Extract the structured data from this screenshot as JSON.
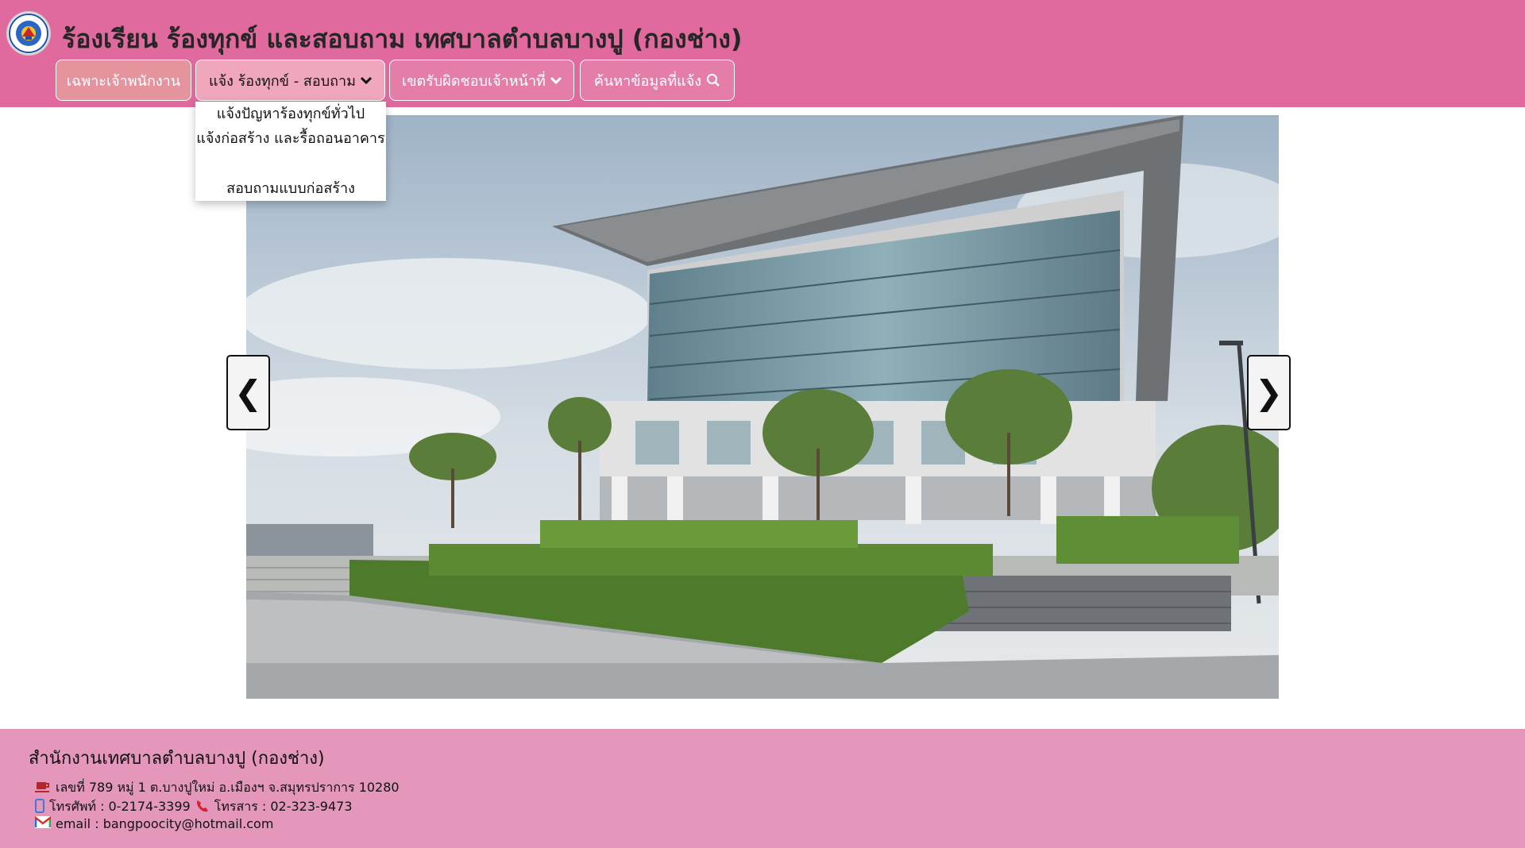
{
  "header": {
    "title": "ร้องเรียน ร้องทุกข์ และสอบถาม เทศบาลตำบลบางปู (กองช่าง)",
    "logo_icon": "municipality-seal-icon"
  },
  "nav": {
    "staff_label": "เฉพาะเจ้าพนักงาน",
    "report_label": "แจ้ง ร้องทุกข์ - สอบถาม",
    "zone_label": "เขตรับผิดชอบเจ้าหน้าที่",
    "search_label": "ค้นหาข้อมูลที่แจ้ง"
  },
  "dropdown": {
    "items": [
      "แจ้งปัญหาร้องทุกข์ทั่วไป",
      "แจ้งก่อสร้าง และรื้อถอนอาคาร",
      "สอบถามแบบก่อสร้าง"
    ]
  },
  "slideshow": {
    "prev_label": "❮",
    "next_label": "❯"
  },
  "footer": {
    "title": "สำนักงานเทศบาลตำบลบางปู (กองช่าง)",
    "address": "เลขที่ 789 หมู่ 1 ต.บางปูใหม่ อ.เมืองฯ จ.สมุทรปราการ 10280",
    "phone": "โทรศัพท์ : 0-2174-3399",
    "fax": "โทรสาร : 02-323-9473",
    "email": "email : bangpoocity@hotmail.com"
  },
  "colors": {
    "header_bg": "#e06a9e",
    "footer_bg": "#e496bb",
    "active_tab_bg": "#f0a7bb"
  }
}
